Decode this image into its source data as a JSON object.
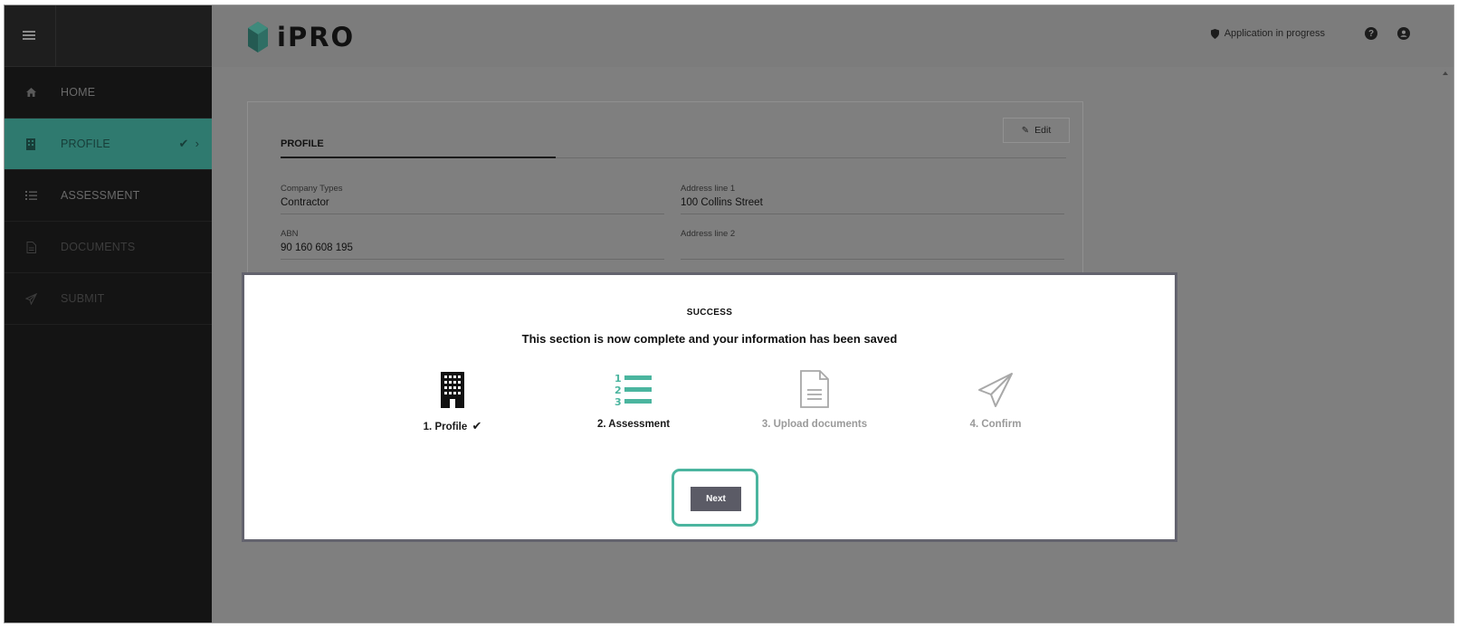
{
  "sidebar": {
    "items": [
      {
        "label": "HOME",
        "icon": "home-icon"
      },
      {
        "label": "PROFILE",
        "icon": "building-icon",
        "state": "complete"
      },
      {
        "label": "ASSESSMENT",
        "icon": "list-icon"
      },
      {
        "label": "DOCUMENTS",
        "icon": "document-icon"
      },
      {
        "label": "SUBMIT",
        "icon": "paper-plane-icon"
      }
    ]
  },
  "header": {
    "brand": "iPRO",
    "status": "Application in progress",
    "help_glyph": "?"
  },
  "profile_card": {
    "tab": "PROFILE",
    "edit_label": "Edit",
    "fields": [
      {
        "label": "Company Types",
        "value": "Contractor"
      },
      {
        "label": "Address line 1",
        "value": "100 Collins Street"
      },
      {
        "label": "ABN",
        "value": "90 160 608 195"
      },
      {
        "label": "Address line 2",
        "value": ""
      }
    ]
  },
  "modal": {
    "heading": "SUCCESS",
    "message": "This section is now complete and your information has been saved",
    "steps": [
      {
        "label": "1. Profile",
        "state": "complete",
        "icon": "building-icon"
      },
      {
        "label": "2. Assessment",
        "state": "current",
        "icon": "numbered-list-icon"
      },
      {
        "label": "3. Upload documents",
        "state": "pending",
        "icon": "document-icon"
      },
      {
        "label": "4. Confirm",
        "state": "pending",
        "icon": "paper-plane-icon"
      }
    ],
    "next_label": "Next"
  },
  "colors": {
    "accent": "#4bb59f",
    "sidebar_bg": "#141414",
    "overlay": "#7f7f7f",
    "button": "#5b5b66"
  }
}
